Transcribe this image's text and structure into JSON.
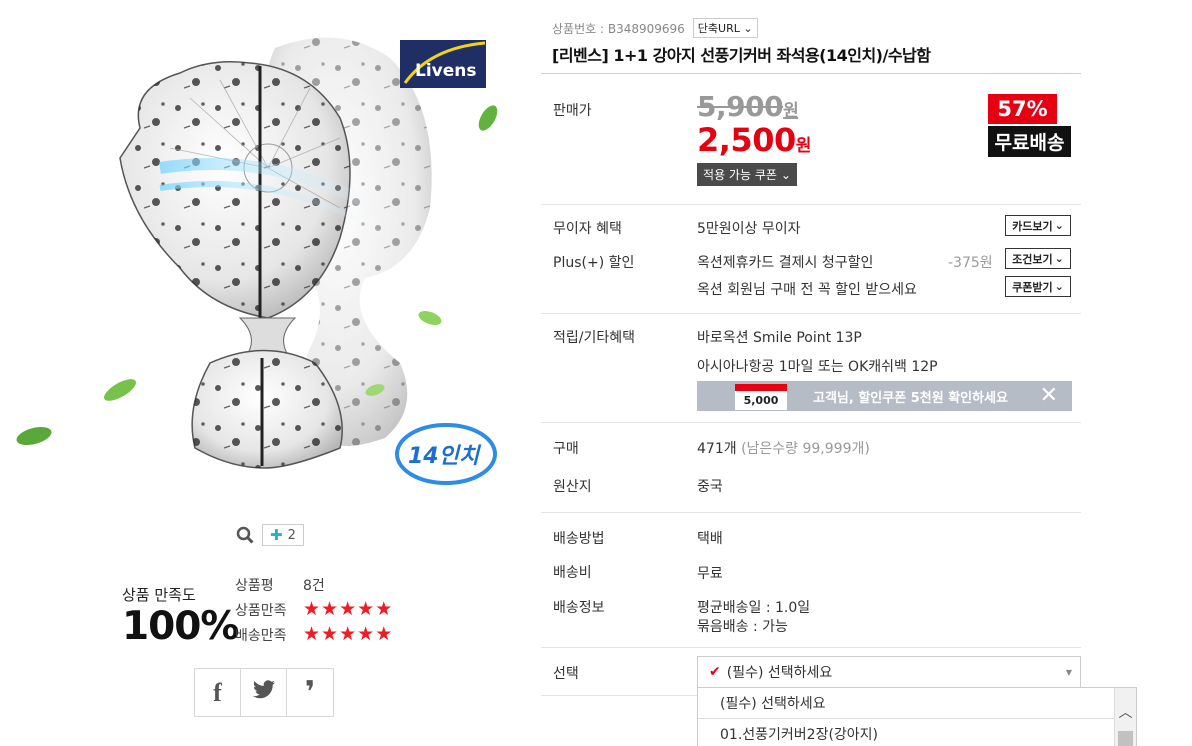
{
  "product": {
    "code_label": "상품번호 : B348909696",
    "short_url_label": "단축URL",
    "title": "[리벤스] 1+1 강아지 선풍기커버 좌석용(14인치)/수납함",
    "brand_logo": "Livens",
    "size_badge": "14인치"
  },
  "gallery": {
    "image_count": "2"
  },
  "satisfaction": {
    "label": "상품 만족도",
    "value": "100%",
    "rows": [
      {
        "label": "상품평",
        "value": "8건"
      },
      {
        "label": "상품만족",
        "stars": 5
      },
      {
        "label": "배송만족",
        "stars": 5
      }
    ]
  },
  "share": {
    "icons": [
      "facebook-icon",
      "twitter-icon",
      "story-icon"
    ],
    "glyphs": [
      "f",
      "t",
      "❜"
    ]
  },
  "price": {
    "label": "판매가",
    "original": "5,900",
    "original_unit": "원",
    "sale": "2,500",
    "sale_unit": "원",
    "discount": "57%",
    "free_shipping": "무료배송",
    "coupon_button": "적용 가능 쿠폰"
  },
  "benefits": {
    "installment_label": "무이자 혜택",
    "installment_value": "5만원이상 무이자",
    "card_button": "카드보기",
    "plus_label": "Plus(+) 할인",
    "plus_value": "옥션제휴카드 결제시 청구할인",
    "plus_amount": "-375원",
    "condition_button": "조건보기",
    "member_value": "옥션 회원님 구매 전 꼭 할인 받으세요",
    "coupon_receive_button": "쿠폰받기"
  },
  "points": {
    "label": "적립/기타혜택",
    "line1": "바로옥션 Smile Point 13P",
    "line2": "아시아나항공 1마일 또는 OK캐쉬백 12P",
    "banner_coupon": "5,000",
    "banner_text": "고객님, 할인쿠폰 5천원 확인하세요"
  },
  "purchase": {
    "label": "구매",
    "count": "471개",
    "remaining": "(남은수량 99,999개)",
    "origin_label": "원산지",
    "origin_value": "중국"
  },
  "delivery": {
    "method_label": "배송방법",
    "method_value": "택배",
    "fee_label": "배송비",
    "fee_value": "무료",
    "info_label": "배송정보",
    "info_line1": "평균배송일 : 1.0일",
    "info_line2": "묶음배송 : 가능"
  },
  "option": {
    "label": "선택",
    "selected": "(필수) 선택하세요",
    "options": [
      "(필수) 선택하세요",
      "01.선풍기커버2장(강아지)"
    ]
  },
  "colors": {
    "accent": "#e60012",
    "dark": "#111111",
    "banner": "#b6bcc6",
    "teal": "#22b3c9"
  }
}
